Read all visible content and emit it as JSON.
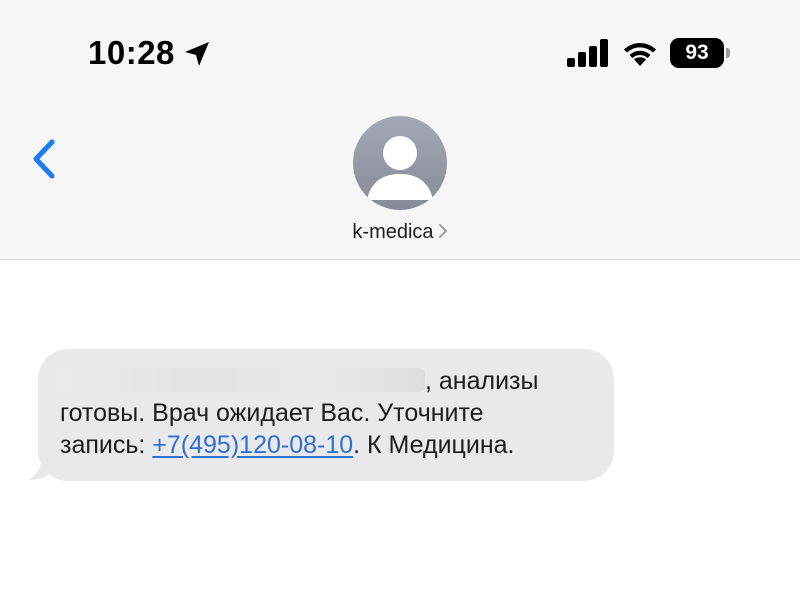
{
  "status_bar": {
    "time": "10:28",
    "battery_level": "93",
    "icons": [
      "location-arrow-icon",
      "cellular-signal-icon",
      "wifi-icon",
      "battery-icon"
    ]
  },
  "nav": {
    "back_icon": "chevron-left-icon",
    "contact_name": "k-medica",
    "contact_chevron_icon": "chevron-right-icon",
    "avatar_icon": "person-silhouette-icon"
  },
  "message": {
    "line1_visible": ", анализы",
    "line2": "готовы. Врач ожидает Вас. Уточните",
    "line3_prefix": "запись: ",
    "phone": "+7(495)120-08-10",
    "line3_suffix": ". К Медицина."
  },
  "colors": {
    "header_bg": "#f6f6f6",
    "bubble_bg": "#e9e9eb",
    "link": "#2f6fd1",
    "back_arrow": "#1a7cf0",
    "avatar": "#9a9fab"
  }
}
